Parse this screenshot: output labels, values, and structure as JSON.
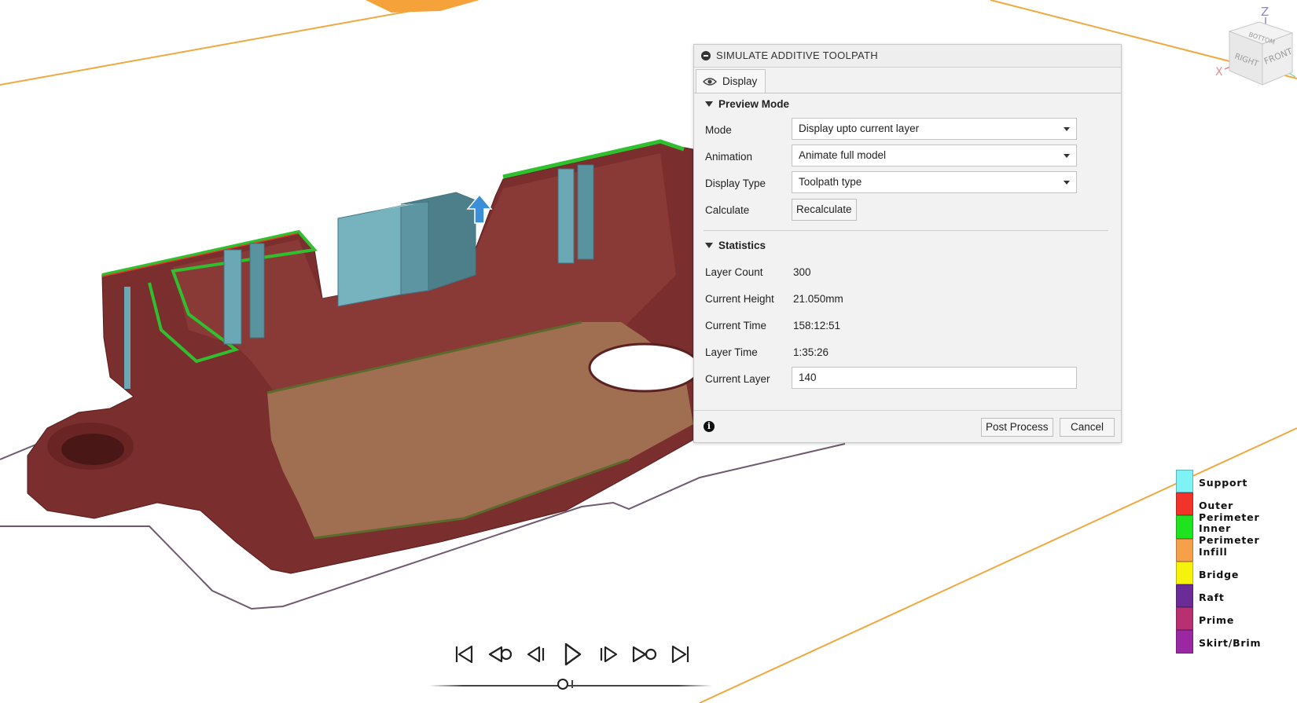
{
  "dialog": {
    "title": "SIMULATE ADDITIVE TOOLPATH",
    "tab_display": "Display",
    "preview_mode": {
      "heading": "Preview Mode",
      "mode_label": "Mode",
      "mode_value": "Display upto current layer",
      "animation_label": "Animation",
      "animation_value": "Animate full model",
      "display_type_label": "Display Type",
      "display_type_value": "Toolpath type",
      "calculate_label": "Calculate",
      "recalculate_button": "Recalculate"
    },
    "statistics": {
      "heading": "Statistics",
      "layer_count_label": "Layer Count",
      "layer_count_value": "300",
      "current_height_label": "Current Height",
      "current_height_value": "21.050mm",
      "current_time_label": "Current Time",
      "current_time_value": "158:12:51",
      "layer_time_label": "Layer Time",
      "layer_time_value": "1:35:26",
      "current_layer_label": "Current Layer",
      "current_layer_value": "140"
    },
    "post_process_button": "Post Process",
    "cancel_button": "Cancel"
  },
  "legend": [
    {
      "label": "Support",
      "color": "#7ef2f5"
    },
    {
      "label": "Outer Perimeter",
      "color": "#f2332a"
    },
    {
      "label": "Inner Perimeter",
      "color": "#1fe31f"
    },
    {
      "label": "Infill",
      "color": "#f7a04a"
    },
    {
      "label": "Bridge",
      "color": "#f6f20c"
    },
    {
      "label": "Raft",
      "color": "#6b2c98"
    },
    {
      "label": "Prime",
      "color": "#b8306f"
    },
    {
      "label": "Skirt/Brim",
      "color": "#9b27a3"
    }
  ],
  "viewcube": {
    "axis_z": "Z",
    "axis_x": "X",
    "face_front": "FRONT",
    "face_right": "RIGHT",
    "face_bottom": "BOTTOM"
  },
  "playback": {
    "progress": 0.467
  },
  "colors": {
    "model_body": "#7a2e2e",
    "build_plate_edge": "#f0a840",
    "support": "#6aa8b5"
  }
}
